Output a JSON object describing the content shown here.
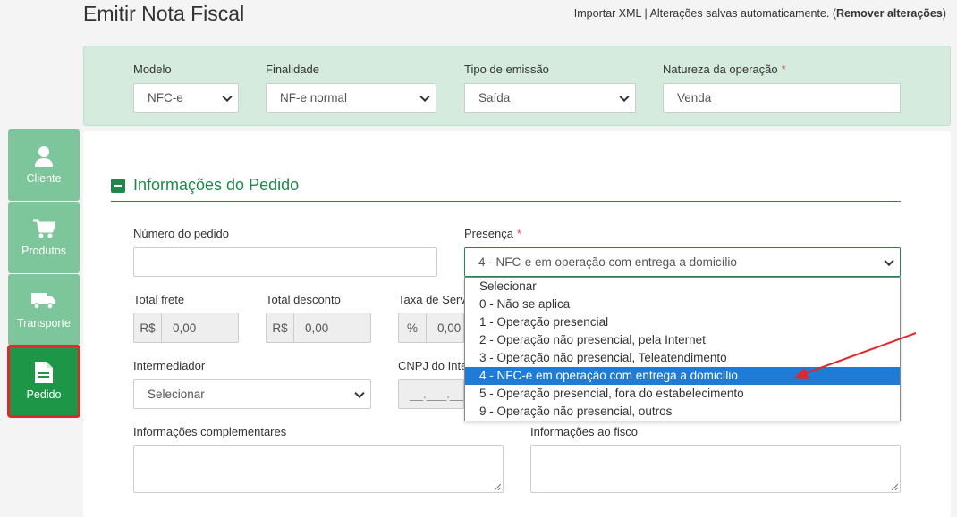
{
  "header": {
    "title": "Emitir Nota Fiscal",
    "import_xml": "Importar XML",
    "separator": " | ",
    "autosave": "Alterações salvas automaticamente. (",
    "remove_changes": "Remover alterações",
    "close_paren": ")"
  },
  "top_form": {
    "modelo": {
      "label": "Modelo",
      "value": "NFC-e"
    },
    "finalidade": {
      "label": "Finalidade",
      "value": "NF-e normal"
    },
    "tipo_emissao": {
      "label": "Tipo de emissão",
      "value": "Saída"
    },
    "natureza": {
      "label": "Natureza da operação",
      "required": "*",
      "value": "Venda"
    }
  },
  "sidebar": {
    "items": [
      {
        "label": "Cliente",
        "icon": "user-icon"
      },
      {
        "label": "Produtos",
        "icon": "cart-icon"
      },
      {
        "label": "Transporte",
        "icon": "truck-icon"
      },
      {
        "label": "Pedido",
        "icon": "document-icon",
        "active": true
      }
    ]
  },
  "section": {
    "title": "Informações do Pedido"
  },
  "fields": {
    "numero_pedido": {
      "label": "Número do pedido",
      "value": ""
    },
    "presenca": {
      "label": "Presença",
      "required": "*",
      "value": "4 - NFC-e em operação com entrega a domicílio"
    },
    "total_frete": {
      "label": "Total frete",
      "prefix": "R$",
      "value": "0,00"
    },
    "total_desconto": {
      "label": "Total desconto",
      "prefix": "R$",
      "value": "0,00"
    },
    "taxa_servico": {
      "label": "Taxa de Servi",
      "prefix": "%",
      "value": "0,00"
    },
    "intermediador": {
      "label": "Intermediador",
      "value": "Selecionar"
    },
    "cnpj": {
      "label": "CNPJ do Inte",
      "value": "__.___.___/"
    },
    "info_complementares": {
      "label": "Informações complementares"
    },
    "info_fisco": {
      "label": "Informações ao fisco"
    }
  },
  "presenca_dropdown": {
    "options": [
      "Selecionar",
      "0 - Não se aplica",
      "1 - Operação presencial",
      "2 - Operação não presencial, pela Internet",
      "3 - Operação não presencial, Teleatendimento",
      "4 - NFC-e em operação com entrega a domicílio",
      "5 - Operação presencial, fora do estabelecimento",
      "9 - Operação não presencial, outros"
    ],
    "selected_index": 5
  },
  "colors": {
    "brand_green": "#21874b",
    "sidebar_green": "#7dc59a",
    "active_green": "#1e9647",
    "highlight_red": "#e3262b",
    "selection_blue": "#1e7bd6"
  }
}
